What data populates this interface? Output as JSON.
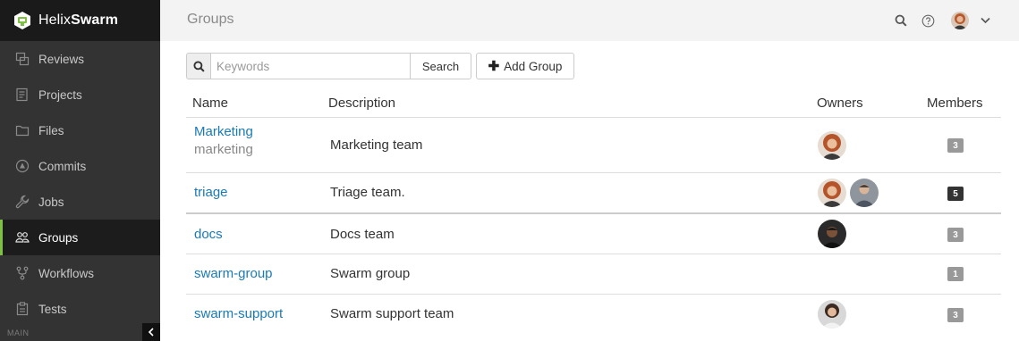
{
  "brand": {
    "prefix": "Helix",
    "name": "Swarm"
  },
  "sidebar": {
    "items": [
      {
        "label": "Reviews",
        "icon": "reviews-icon",
        "active": false
      },
      {
        "label": "Projects",
        "icon": "projects-icon",
        "active": false
      },
      {
        "label": "Files",
        "icon": "folder-icon",
        "active": false
      },
      {
        "label": "Commits",
        "icon": "commits-icon",
        "active": false
      },
      {
        "label": "Jobs",
        "icon": "wrench-icon",
        "active": false
      },
      {
        "label": "Groups",
        "icon": "users-icon",
        "active": true
      },
      {
        "label": "Workflows",
        "icon": "workflow-icon",
        "active": false
      },
      {
        "label": "Tests",
        "icon": "clipboard-icon",
        "active": false
      }
    ],
    "footer_label": "MAIN"
  },
  "header": {
    "title": "Groups"
  },
  "toolbar": {
    "search_placeholder": "Keywords",
    "search_button": "Search",
    "add_button": "Add Group"
  },
  "table": {
    "columns": [
      "Name",
      "Description",
      "Owners",
      "Members"
    ],
    "rows": [
      {
        "name": "Marketing",
        "id": "marketing",
        "description": "Marketing team",
        "owners": [
          "owner-1"
        ],
        "members": "3"
      },
      {
        "name": "triage",
        "id": "",
        "description": "Triage team.",
        "owners": [
          "owner-1",
          "owner-2"
        ],
        "members": "5"
      },
      {
        "name": "docs",
        "id": "",
        "description": "Docs team",
        "owners": [
          "owner-3"
        ],
        "members": "3"
      },
      {
        "name": "swarm-group",
        "id": "",
        "description": "Swarm group",
        "owners": [],
        "members": "1"
      },
      {
        "name": "swarm-support",
        "id": "",
        "description": "Swarm support team",
        "owners": [
          "owner-4"
        ],
        "members": "3"
      }
    ]
  },
  "colors": {
    "accent": "#7cc142",
    "link": "#1a7ab5",
    "badge": "#999999",
    "badge_dark": "#333333"
  }
}
